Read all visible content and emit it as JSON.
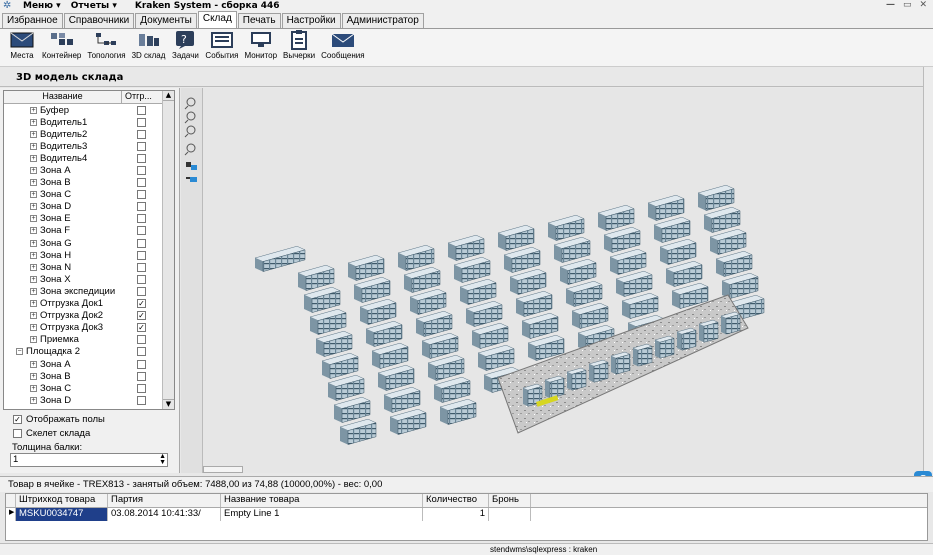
{
  "titlebar": {
    "menu": "Меню ▾",
    "reports": "Отчеты ▾",
    "title": "Kraken System - сборка 446"
  },
  "tabs": [
    {
      "label": "Избранное"
    },
    {
      "label": "Справочники"
    },
    {
      "label": "Документы"
    },
    {
      "label": "Склад",
      "active": true
    },
    {
      "label": "Печать"
    },
    {
      "label": "Настройки"
    },
    {
      "label": "Администратор"
    }
  ],
  "toolbar": [
    {
      "label": "Места",
      "icon": "envelope-icon"
    },
    {
      "label": "Контейнер",
      "icon": "container-icon"
    },
    {
      "label": "Топология",
      "icon": "topology-icon"
    },
    {
      "label": "3D склад",
      "icon": "3d-warehouse-icon"
    },
    {
      "label": "Задачи",
      "icon": "tasks-icon"
    },
    {
      "label": "События",
      "icon": "events-icon"
    },
    {
      "label": "Монитор",
      "icon": "monitor-icon"
    },
    {
      "label": "Вычерки",
      "icon": "clipboard-icon"
    },
    {
      "label": "Сообщения",
      "icon": "messages-icon"
    }
  ],
  "view_title": "3D модель склада",
  "tree": {
    "col_name": "Название",
    "col_ship": "Отгр...",
    "rows": [
      {
        "label": "Буфер",
        "checked": false,
        "indent": 1
      },
      {
        "label": "Водитель1",
        "checked": false,
        "indent": 1
      },
      {
        "label": "Водитель2",
        "checked": false,
        "indent": 1
      },
      {
        "label": "Водитель3",
        "checked": false,
        "indent": 1
      },
      {
        "label": "Водитель4",
        "checked": false,
        "indent": 1
      },
      {
        "label": "Зона A",
        "checked": false,
        "indent": 1
      },
      {
        "label": "Зона B",
        "checked": false,
        "indent": 1
      },
      {
        "label": "Зона C",
        "checked": false,
        "indent": 1
      },
      {
        "label": "Зона D",
        "checked": false,
        "indent": 1
      },
      {
        "label": "Зона E",
        "checked": false,
        "indent": 1
      },
      {
        "label": "Зона F",
        "checked": false,
        "indent": 1
      },
      {
        "label": "Зона G",
        "checked": false,
        "indent": 1
      },
      {
        "label": "Зона H",
        "checked": false,
        "indent": 1
      },
      {
        "label": "Зона N",
        "checked": false,
        "indent": 1
      },
      {
        "label": "Зона X",
        "checked": false,
        "indent": 1
      },
      {
        "label": "Зона экспедиции",
        "checked": false,
        "indent": 1
      },
      {
        "label": "Отгрузка Док1",
        "checked": true,
        "indent": 1
      },
      {
        "label": "Отгрузка Док2",
        "checked": true,
        "indent": 1
      },
      {
        "label": "Отгрузка Док3",
        "checked": true,
        "indent": 1
      },
      {
        "label": "Приемка",
        "checked": false,
        "indent": 1
      },
      {
        "label": "Площадка 2",
        "checked": false,
        "indent": 0,
        "expanded": true
      },
      {
        "label": "Зона A",
        "checked": false,
        "indent": 1
      },
      {
        "label": "Зона B",
        "checked": false,
        "indent": 1
      },
      {
        "label": "Зона C",
        "checked": false,
        "indent": 1
      },
      {
        "label": "Зона D",
        "checked": false,
        "indent": 1
      }
    ]
  },
  "options": {
    "show_floors": {
      "label": "Отображать полы",
      "checked": true
    },
    "skeleton": {
      "label": "Скелет склада",
      "checked": false
    },
    "beam_label": "Толщина балки:",
    "beam_value": "1"
  },
  "cell_info": "Товар в ячейке - TREX813 - занятый объем: 7488,00 из 74,88 (10000,00%)  - вес: 0,00",
  "grid": {
    "columns": [
      "Штрихкод товара",
      "Партия",
      "Название товара",
      "Количество",
      "Бронь"
    ],
    "rows": [
      {
        "barcode": "MSKU0034747",
        "batch": "03.08.2014 10:41:33/",
        "name": "Empty Line 1",
        "qty": "1",
        "reserve": ""
      }
    ]
  },
  "status": "stendwms\\sqlexpress : kraken"
}
